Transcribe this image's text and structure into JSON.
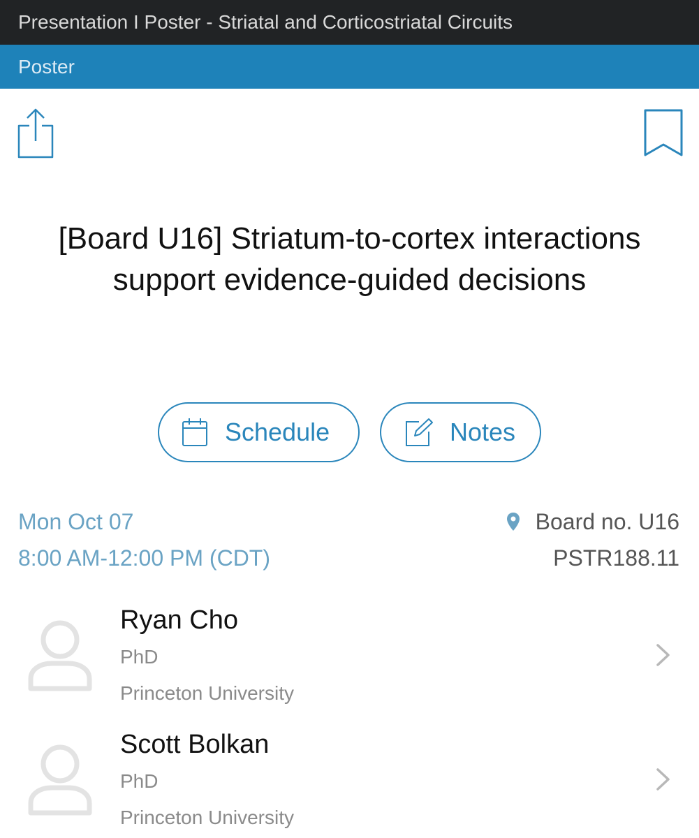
{
  "header": {
    "title": "Presentation I Poster - Striatal and Corticostriatal Circuits",
    "subtitle": "Poster"
  },
  "actions": {
    "share_icon": "share-icon",
    "bookmark_icon": "bookmark-icon"
  },
  "poster": {
    "title": "[Board U16] Striatum-to-cortex interactions support evidence-guided decisions"
  },
  "buttons": {
    "schedule_label": "Schedule",
    "notes_label": "Notes"
  },
  "session": {
    "date": "Mon Oct 07",
    "time": "8:00 AM-12:00 PM (CDT)",
    "board": "Board no. U16",
    "code": "PSTR188.11"
  },
  "authors": [
    {
      "name": "Ryan Cho",
      "degree": "PhD",
      "affiliation": "Princeton University"
    },
    {
      "name": "Scott Bolkan",
      "degree": "PhD",
      "affiliation": "Princeton University"
    }
  ],
  "colors": {
    "top_bar": "#212325",
    "accent_bar": "#1e82b9",
    "accent": "#2a86bb",
    "date_text": "#6aa3c4"
  }
}
